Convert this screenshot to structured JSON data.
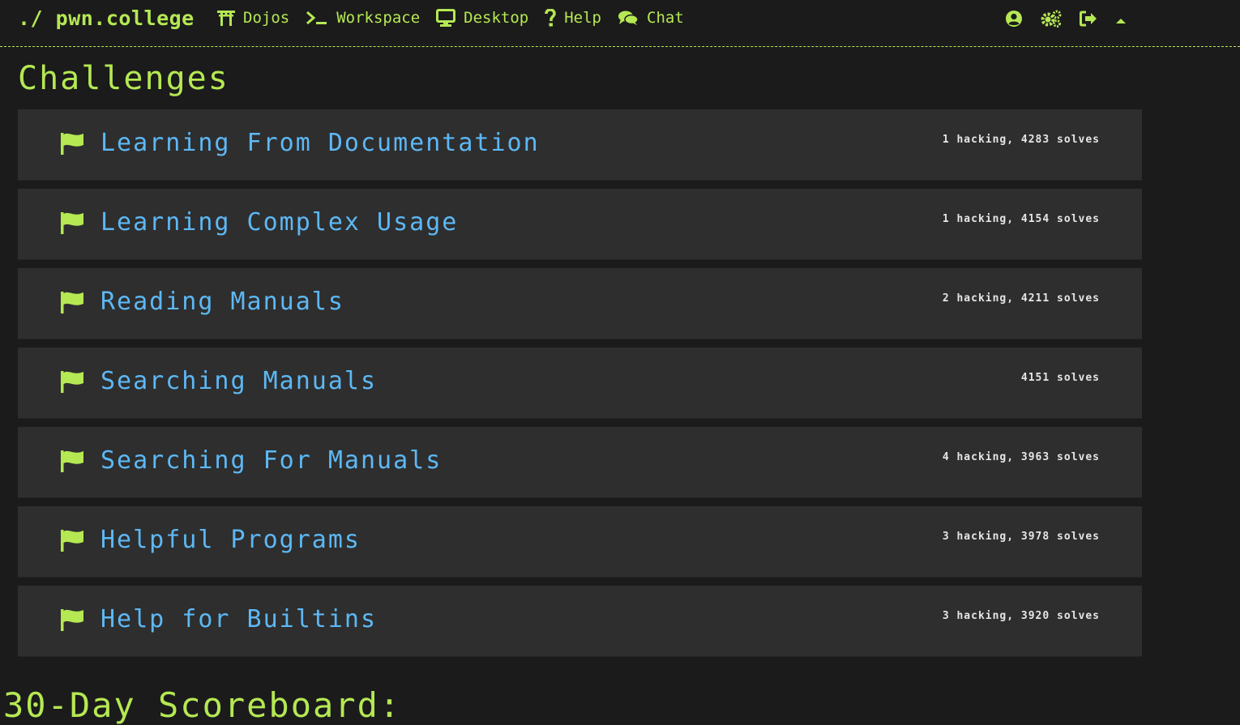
{
  "navbar": {
    "brand": "./ pwn.college",
    "links": [
      {
        "label": "Dojos",
        "icon": "torii-gate-icon"
      },
      {
        "label": "Workspace",
        "icon": "terminal-icon"
      },
      {
        "label": "Desktop",
        "icon": "desktop-icon"
      },
      {
        "label": "Help",
        "icon": "question-icon"
      },
      {
        "label": "Chat",
        "icon": "chat-bubbles-icon"
      }
    ],
    "right_icons": [
      "user-circle-icon",
      "settings-icon",
      "logout-icon",
      "caret-up-icon"
    ]
  },
  "page": {
    "title": "Challenges",
    "scoreboard_title": "30-Day Scoreboard:"
  },
  "challenges": [
    {
      "name": "Learning From Documentation",
      "stats": "1 hacking, 4283 solves"
    },
    {
      "name": "Learning Complex Usage",
      "stats": "1 hacking, 4154 solves"
    },
    {
      "name": "Reading Manuals",
      "stats": "2 hacking, 4211 solves"
    },
    {
      "name": "Searching Manuals",
      "stats": "4151 solves"
    },
    {
      "name": "Searching For Manuals",
      "stats": "4 hacking, 3963 solves"
    },
    {
      "name": "Helpful Programs",
      "stats": "3 hacking, 3978 solves"
    },
    {
      "name": "Help for Builtins",
      "stats": "3 hacking, 3920 solves"
    }
  ],
  "colors": {
    "background": "#1b1b1b",
    "accent": "#b5e853",
    "challenge_name": "#5db8f5",
    "card": "#2e2e2e",
    "stats": "#e6e6e6"
  }
}
